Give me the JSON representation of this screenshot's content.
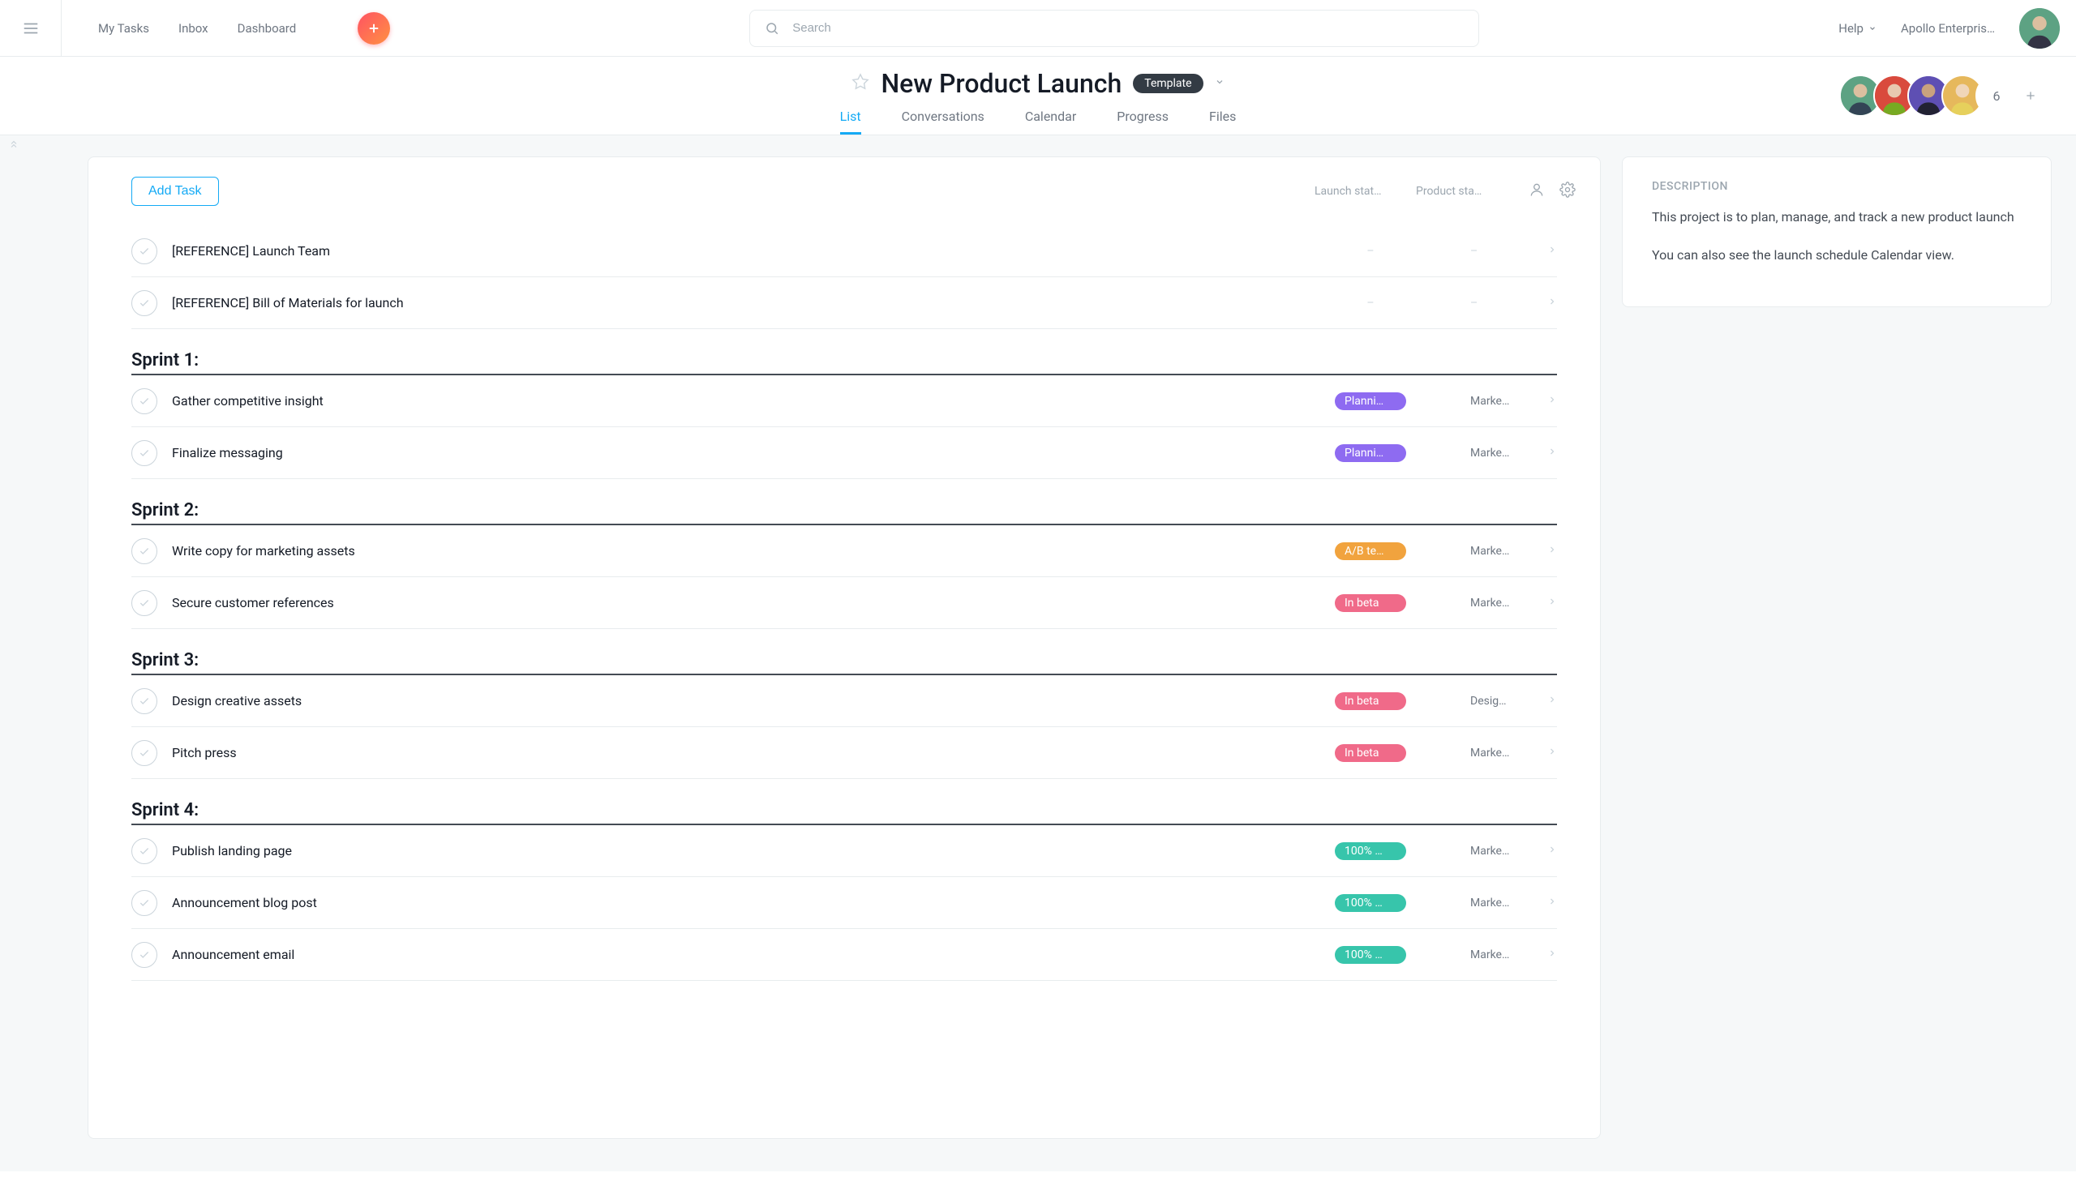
{
  "topnav": {
    "links": [
      "My Tasks",
      "Inbox",
      "Dashboard"
    ],
    "search_placeholder": "Search",
    "help_label": "Help",
    "org_label": "Apollo Enterpris…"
  },
  "project": {
    "title": "New Product Launch",
    "template_label": "Template",
    "tabs": [
      "List",
      "Conversations",
      "Calendar",
      "Progress",
      "Files"
    ],
    "active_tab": 0,
    "member_overflow": "6"
  },
  "member_colors": [
    "#5da283",
    "#d94a3d",
    "#5e4fb3",
    "#e6b85c"
  ],
  "list": {
    "add_task_label": "Add Task",
    "col1": "Launch stat…",
    "col2": "Product sta…"
  },
  "ungrouped_tasks": [
    {
      "name": "[REFERENCE] Launch Team",
      "status": null,
      "stage": null
    },
    {
      "name": "[REFERENCE] Bill of Materials for launch",
      "status": null,
      "stage": null
    }
  ],
  "sections": [
    {
      "title": "Sprint 1:",
      "tasks": [
        {
          "name": "Gather competitive insight",
          "status": "Planni…",
          "status_color": "purple",
          "stage": "Marke…"
        },
        {
          "name": "Finalize messaging",
          "status": "Planni…",
          "status_color": "purple",
          "stage": "Marke…"
        }
      ]
    },
    {
      "title": "Sprint 2:",
      "tasks": [
        {
          "name": "Write copy for marketing assets",
          "status": "A/B te…",
          "status_color": "orange",
          "stage": "Marke…"
        },
        {
          "name": "Secure customer references",
          "status": "In beta",
          "status_color": "pink",
          "stage": "Marke…"
        }
      ]
    },
    {
      "title": "Sprint 3:",
      "tasks": [
        {
          "name": "Design creative assets",
          "status": "In beta",
          "status_color": "pink",
          "stage": "Desig…"
        },
        {
          "name": "Pitch press",
          "status": "In beta",
          "status_color": "pink",
          "stage": "Marke…"
        }
      ]
    },
    {
      "title": "Sprint 4:",
      "tasks": [
        {
          "name": "Publish landing page",
          "status": "100% …",
          "status_color": "teal",
          "stage": "Marke…"
        },
        {
          "name": "Announcement blog post",
          "status": "100% …",
          "status_color": "teal",
          "stage": "Marke…"
        },
        {
          "name": "Announcement email",
          "status": "100% …",
          "status_color": "teal",
          "stage": "Marke…"
        }
      ]
    }
  ],
  "description": {
    "label": "DESCRIPTION",
    "p1": "This project is to plan, manage, and track a new product launch",
    "p2": "You can also see the launch schedule Calendar view."
  }
}
